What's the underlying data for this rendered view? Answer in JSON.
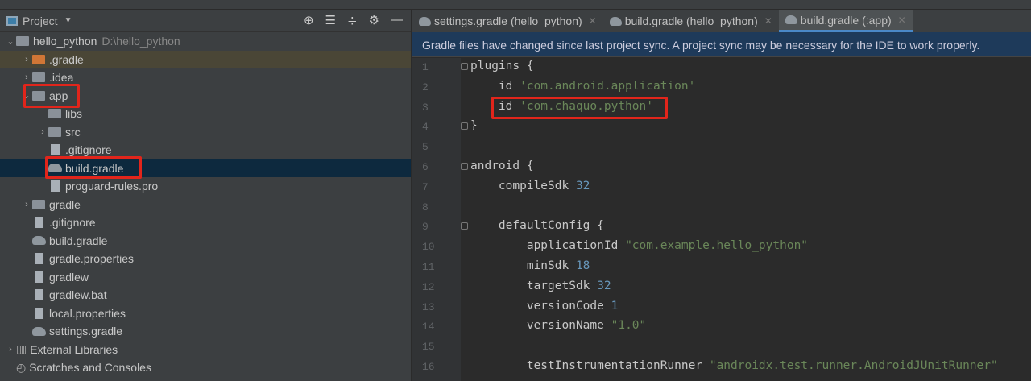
{
  "sidebar": {
    "title": "Project",
    "tools": [
      "locate-icon",
      "expand-all-icon",
      "collapse-all-icon",
      "gear-icon",
      "minimize-icon"
    ],
    "tree": [
      {
        "label": "hello_python",
        "path": "D:\\hello_python",
        "level": 0,
        "type": "module",
        "open": true
      },
      {
        "label": ".gradle",
        "level": 1,
        "type": "folder-orange",
        "open": false
      },
      {
        "label": ".idea",
        "level": 1,
        "type": "folder",
        "open": false
      },
      {
        "label": "app",
        "level": 1,
        "type": "module",
        "open": true
      },
      {
        "label": "libs",
        "level": 2,
        "type": "folder"
      },
      {
        "label": "src",
        "level": 2,
        "type": "folder",
        "open": false
      },
      {
        "label": ".gitignore",
        "level": 2,
        "type": "file"
      },
      {
        "label": "build.gradle",
        "level": 2,
        "type": "gradle",
        "selected": true
      },
      {
        "label": "proguard-rules.pro",
        "level": 2,
        "type": "file"
      },
      {
        "label": "gradle",
        "level": 1,
        "type": "folder",
        "open": false
      },
      {
        "label": ".gitignore",
        "level": 1,
        "type": "file"
      },
      {
        "label": "build.gradle",
        "level": 1,
        "type": "gradle"
      },
      {
        "label": "gradle.properties",
        "level": 1,
        "type": "file"
      },
      {
        "label": "gradlew",
        "level": 1,
        "type": "file"
      },
      {
        "label": "gradlew.bat",
        "level": 1,
        "type": "file"
      },
      {
        "label": "local.properties",
        "level": 1,
        "type": "file"
      },
      {
        "label": "settings.gradle",
        "level": 1,
        "type": "gradle"
      },
      {
        "label": "External Libraries",
        "level": 0,
        "type": "lib",
        "open": false
      },
      {
        "label": "Scratches and Consoles",
        "level": 0,
        "type": "scratch"
      }
    ]
  },
  "tabs": [
    {
      "label": "settings.gradle (hello_python)"
    },
    {
      "label": "build.gradle (hello_python)"
    },
    {
      "label": "build.gradle (:app)",
      "active": true
    }
  ],
  "banner": "Gradle files have changed since last project sync. A project sync may be necessary for the IDE to work properly.",
  "code": [
    [
      [
        "",
        "plugins {"
      ]
    ],
    [
      [
        "",
        "    id "
      ],
      [
        "str",
        "'com.android.application'"
      ]
    ],
    [
      [
        "",
        "    id "
      ],
      [
        "str",
        "'com.chaquo.python'"
      ]
    ],
    [
      [
        "",
        "}"
      ]
    ],
    [
      [
        "",
        ""
      ]
    ],
    [
      [
        "",
        "android {"
      ]
    ],
    [
      [
        "",
        "    compileSdk "
      ],
      [
        "num",
        "32"
      ]
    ],
    [
      [
        "",
        ""
      ]
    ],
    [
      [
        "",
        "    defaultConfig {"
      ]
    ],
    [
      [
        "",
        "        applicationId "
      ],
      [
        "str",
        "\"com.example.hello_python\""
      ]
    ],
    [
      [
        "",
        "        minSdk "
      ],
      [
        "num",
        "18"
      ]
    ],
    [
      [
        "",
        "        targetSdk "
      ],
      [
        "num",
        "32"
      ]
    ],
    [
      [
        "",
        "        versionCode "
      ],
      [
        "num",
        "1"
      ]
    ],
    [
      [
        "",
        "        versionName "
      ],
      [
        "str",
        "\"1.0\""
      ]
    ],
    [
      [
        "",
        ""
      ]
    ],
    [
      [
        "",
        "        testInstrumentationRunner "
      ],
      [
        "str",
        "\"androidx.test.runner.AndroidJUnitRunner\""
      ]
    ]
  ]
}
